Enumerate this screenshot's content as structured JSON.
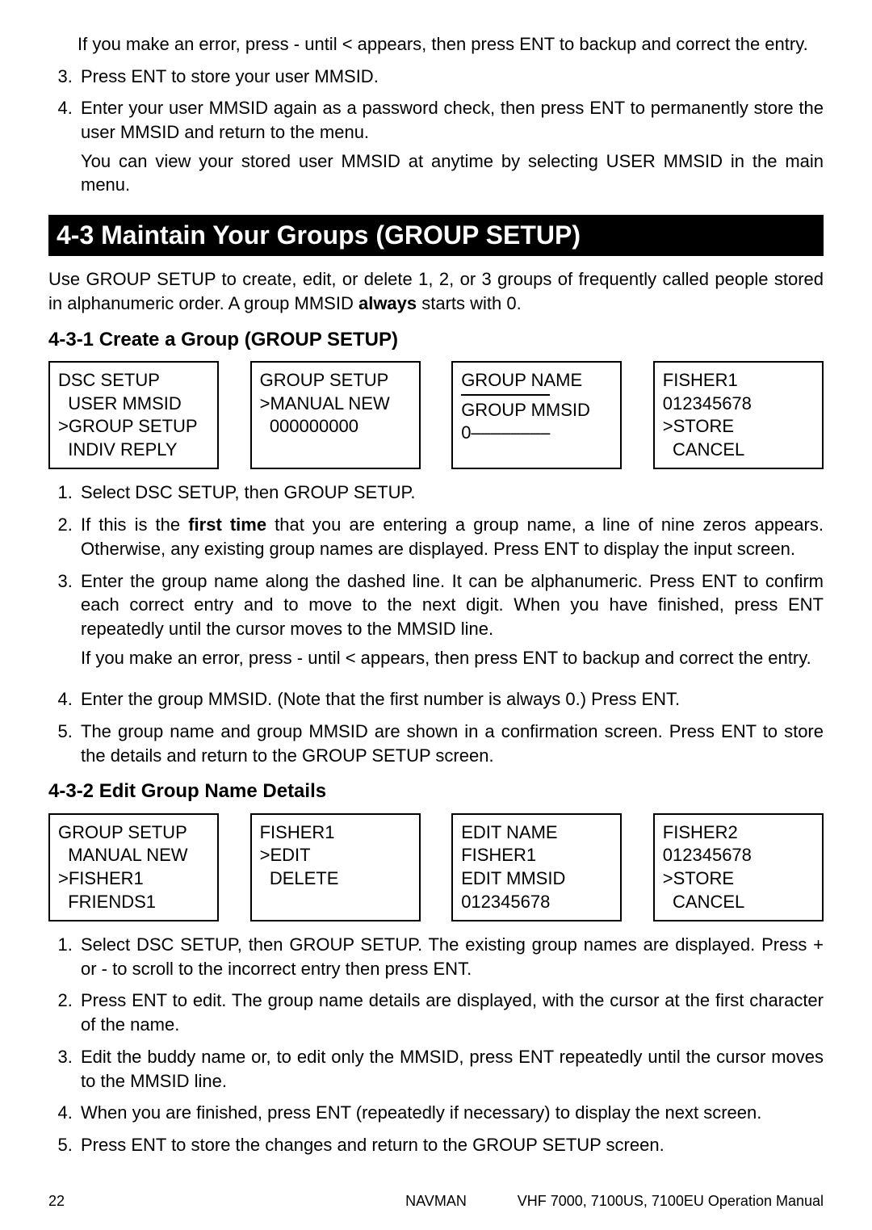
{
  "top": {
    "errTip": "If you make an error, press - until < appears, then press ENT to backup and correct the entry.",
    "step3": "Press ENT to store your user MMSID.",
    "step4a": "Enter your user MMSID again as a password check, then press ENT to permanently store the user MMSID and return to the menu.",
    "step4b": "You can view your stored user MMSID at anytime by selecting USER MMSID in the main menu."
  },
  "section43": {
    "title": "4-3 Maintain Your Groups (GROUP SETUP)",
    "intro_a": "Use GROUP SETUP to create, edit, or delete 1, 2, or 3 groups of frequently called people stored in alphanumeric order. A group MMSID ",
    "intro_bold": "always",
    "intro_b": " starts with 0."
  },
  "section431": {
    "title": "4-3-1 Create a Group (GROUP SETUP)",
    "screens": {
      "s1": "DSC SETUP\n  USER MMSID\n>GROUP SETUP\n  INDIV REPLY",
      "s2": "GROUP SETUP\n>MANUAL NEW\n  000000000",
      "s3_top": "GROUP NAME",
      "s3_mid": "GROUP MMSID",
      "s3_bot": "0––––––––",
      "s4": "FISHER1\n012345678\n>STORE\n  CANCEL"
    },
    "step1": "Select DSC SETUP, then GROUP SETUP.",
    "step2a": "If this is the ",
    "step2bold": "first time",
    "step2b": " that you are entering a group name, a line of nine zeros appears. Otherwise, any existing group names are displayed. Press ENT to display the input screen.",
    "step3": "Enter the group name along the dashed line. It can be alphanumeric. Press ENT to confirm each correct entry and to move to the next digit. When you have finished, press ENT repeatedly until the cursor moves to the MMSID line.",
    "step3b": "If you make an error, press - until < appears, then press ENT to backup and correct the entry.",
    "step4": "Enter the group MMSID. (Note that the first number is always 0.) Press ENT.",
    "step5": "The group name and group MMSID are shown in a confirmation screen. Press ENT to store the details and return to the GROUP SETUP screen."
  },
  "section432": {
    "title": "4-3-2 Edit Group Name Details",
    "screens": {
      "s1": "GROUP SETUP\n  MANUAL NEW\n>FISHER1\n  FRIENDS1",
      "s2": "FISHER1\n>EDIT\n  DELETE",
      "s3": "EDIT NAME\nFISHER1\nEDIT MMSID\n012345678",
      "s4": "FISHER2\n012345678\n>STORE\n  CANCEL"
    },
    "step1": "Select DSC SETUP, then GROUP SETUP. The existing group names are displayed. Press + or - to scroll to the incorrect entry then press ENT.",
    "step2": "Press ENT to edit. The group name details are displayed, with the cursor at the first character of the name.",
    "step3": "Edit the buddy name or, to edit only the MMSID, press ENT repeatedly until the cursor moves to the MMSID line.",
    "step4": "When you are finished, press ENT (repeatedly if necessary) to display the next screen.",
    "step5": "Press ENT to store the changes and return to the GROUP SETUP screen."
  },
  "footer": {
    "page": "22",
    "brand": "NAVMAN",
    "doc": "VHF 7000, 7100US, 7100EU Operation Manual"
  }
}
